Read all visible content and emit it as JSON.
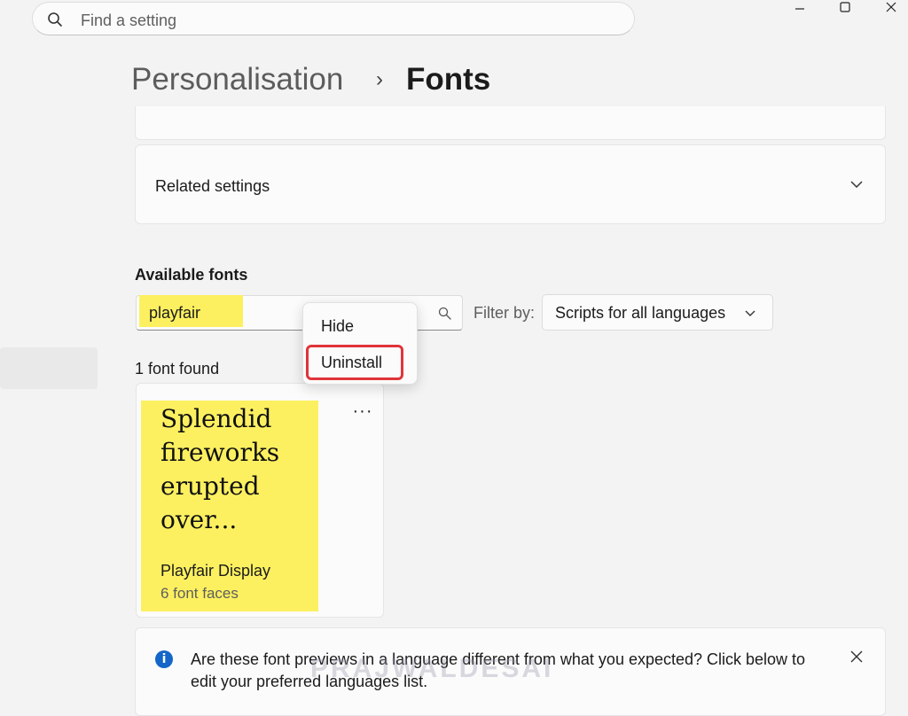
{
  "search": {
    "placeholder": "Find a setting"
  },
  "breadcrumb": {
    "parent": "Personalisation",
    "separator": "›",
    "current": "Fonts"
  },
  "related_settings": {
    "label": "Related settings"
  },
  "available_fonts": {
    "title": "Available fonts",
    "search_value": "playfair",
    "filter_label": "Filter by:",
    "filter_selected": "Scripts for all languages",
    "count_text": "1 font found",
    "font": {
      "preview": "Splendid fireworks erupted over...",
      "name": "Playfair Display",
      "faces": "6 font faces",
      "more_label": "···"
    }
  },
  "context_menu": {
    "items": [
      "Hide",
      "Uninstall"
    ]
  },
  "info_banner": {
    "text": "Are these font previews in a language different from what you expected? Click below to edit your preferred languages list."
  },
  "watermark": "PRAJWALDESAI",
  "colors": {
    "highlight": "#fdf060",
    "accent": "#1466c9",
    "annotation_red": "#e0343a"
  }
}
